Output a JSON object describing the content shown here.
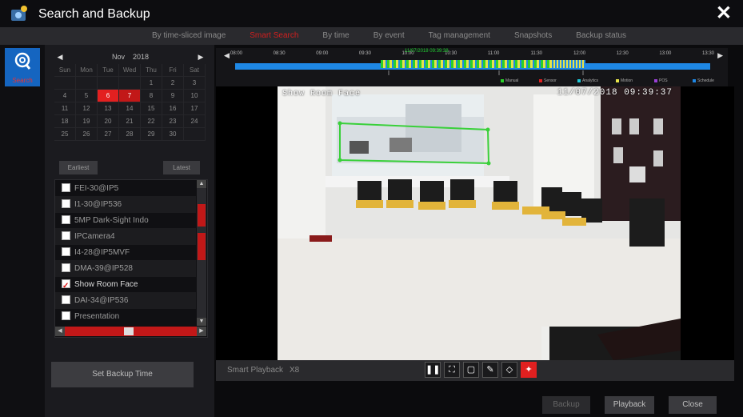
{
  "window": {
    "title": "Search and Backup"
  },
  "tabs": [
    {
      "label": "By time-sliced image"
    },
    {
      "label": "Smart Search"
    },
    {
      "label": "By time"
    },
    {
      "label": "By event"
    },
    {
      "label": "Tag management"
    },
    {
      "label": "Snapshots"
    },
    {
      "label": "Backup status"
    }
  ],
  "active_tab": "Smart Search",
  "nav": {
    "search_label": "Search"
  },
  "calendar": {
    "month": "Nov",
    "year": "2018",
    "weekdays": [
      "Sun",
      "Mon",
      "Tue",
      "Wed",
      "Thu",
      "Fri",
      "Sat"
    ],
    "rows": [
      [
        "",
        "",
        "",
        "",
        "1",
        "2",
        "3"
      ],
      [
        "4",
        "5",
        "6",
        "7",
        "8",
        "9",
        "10"
      ],
      [
        "11",
        "12",
        "13",
        "14",
        "15",
        "16",
        "17"
      ],
      [
        "18",
        "19",
        "20",
        "21",
        "22",
        "23",
        "24"
      ],
      [
        "25",
        "26",
        "27",
        "28",
        "29",
        "30",
        ""
      ]
    ],
    "record_days": [
      "6"
    ],
    "selected_day": "7",
    "earliest_label": "Earliest",
    "latest_label": "Latest"
  },
  "cameras": [
    {
      "name": "FEI-30@IP5",
      "checked": false
    },
    {
      "name": "I1-30@IP536",
      "checked": false
    },
    {
      "name": "5MP Dark-Sight Indo",
      "checked": false
    },
    {
      "name": "IPCamera4",
      "checked": false
    },
    {
      "name": "I4-28@IP5MVF",
      "checked": false
    },
    {
      "name": "DMA-39@IP528",
      "checked": false
    },
    {
      "name": "Show Room Face",
      "checked": true
    },
    {
      "name": "DAI-34@IP536",
      "checked": false
    },
    {
      "name": "Presentation",
      "checked": false
    }
  ],
  "set_backup_time_label": "Set Backup Time",
  "timeline": {
    "labels": [
      "08:00",
      "08:30",
      "09:00",
      "09:30",
      "10:00",
      "10:30",
      "11:00",
      "11:30",
      "12:00",
      "12:30",
      "13:00",
      "13:30"
    ],
    "current": "11/07/2018 09:39:38",
    "legend": [
      {
        "label": "Manual",
        "color": "#2ad02a"
      },
      {
        "label": "Sensor",
        "color": "#e02020"
      },
      {
        "label": "Analytics",
        "color": "#1ec8d8"
      },
      {
        "label": "Motion",
        "color": "#e6e24a"
      },
      {
        "label": "POS",
        "color": "#9b40d8"
      },
      {
        "label": "Schedule",
        "color": "#1e88e5"
      }
    ]
  },
  "video": {
    "osd_name": "Show Room Face",
    "osd_time": "11/07/2018 09:39:37"
  },
  "playback": {
    "mode_label": "Smart Playback",
    "speed": "X8"
  },
  "buttons": {
    "backup": "Backup",
    "playback": "Playback",
    "close": "Close"
  }
}
